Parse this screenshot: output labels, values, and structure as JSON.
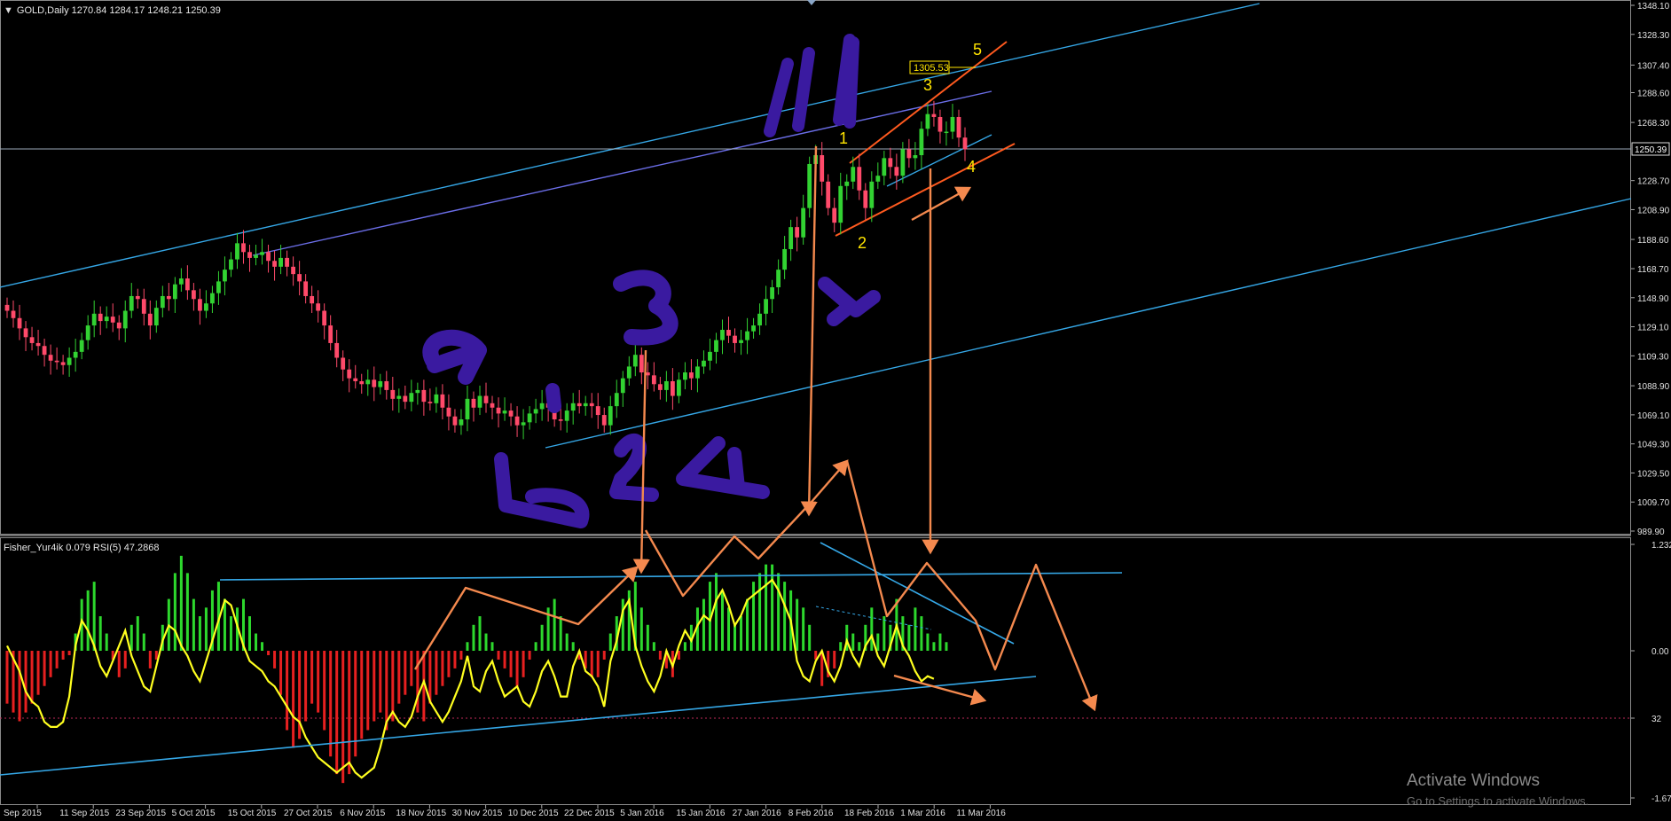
{
  "price_panel": {
    "title": "GOLD,Daily  1270.84 1284.17 1248.21 1250.39",
    "current_price_label": "1250.39",
    "target_label": "1305.53",
    "wave_labels": [
      "1",
      "2",
      "3",
      "4",
      "5"
    ]
  },
  "indicator_panel": {
    "title": "Fisher_Yur4ik 0.079  RSI(5) 47.2868"
  },
  "watermark": {
    "line1": "Activate Windows",
    "line2": "Go to Settings to activate Windows."
  },
  "colors": {
    "up_candle": "#32d232",
    "down_candle": "#ff4a6a",
    "channel_line": "#35a7e6",
    "inner_line": "#6b6ee8",
    "annotation_arrow": "#f4894e",
    "wave_channel": "#ff5a1f",
    "marker_ink": "#3a1aa0",
    "rsi_line": "#ffff1f",
    "fisher_positive": "#2dd82d",
    "fisher_negative": "#e62020",
    "wave_label": "#ffe400"
  },
  "chart_data": [
    {
      "type": "candlestick",
      "title": "GOLD,Daily",
      "price_axis_ticks": [
        "1348.10",
        "1328.30",
        "1307.40",
        "1288.60",
        "1268.30",
        "1250.39",
        "1228.70",
        "1208.90",
        "1188.60",
        "1168.70",
        "1148.90",
        "1129.10",
        "1109.30",
        "1088.90",
        "1069.10",
        "1049.30",
        "1029.50",
        "1009.70",
        "989.90"
      ],
      "ylim": [
        989.9,
        1348.1
      ],
      "date_axis_ticks": [
        "Sep 2015",
        "11 Sep 2015",
        "23 Sep 2015",
        "5 Oct 2015",
        "15 Oct 2015",
        "27 Oct 2015",
        "6 Nov 2015",
        "18 Nov 2015",
        "30 Nov 2015",
        "10 Dec 2015",
        "22 Dec 2015",
        "5 Jan 2016",
        "15 Jan 2016",
        "27 Jan 2016",
        "8 Feb 2016",
        "18 Feb 2016",
        "1 Mar 2016",
        "11 Mar 2016"
      ],
      "close": [
        1140,
        1135,
        1128,
        1122,
        1118,
        1116,
        1110,
        1106,
        1105,
        1103,
        1108,
        1112,
        1120,
        1130,
        1138,
        1133,
        1136,
        1132,
        1128,
        1140,
        1150,
        1148,
        1138,
        1130,
        1142,
        1150,
        1148,
        1158,
        1162,
        1154,
        1148,
        1140,
        1145,
        1152,
        1160,
        1168,
        1175,
        1186,
        1180,
        1176,
        1178,
        1180,
        1174,
        1170,
        1176,
        1170,
        1165,
        1160,
        1150,
        1145,
        1140,
        1130,
        1118,
        1108,
        1100,
        1094,
        1092,
        1090,
        1093,
        1088,
        1092,
        1086,
        1080,
        1082,
        1078,
        1084,
        1086,
        1078,
        1077,
        1083,
        1074,
        1068,
        1062,
        1066,
        1080,
        1074,
        1082,
        1077,
        1074,
        1070,
        1072,
        1068,
        1062,
        1064,
        1070,
        1073,
        1077,
        1074,
        1066,
        1065,
        1072,
        1077,
        1075,
        1077,
        1075,
        1069,
        1062,
        1075,
        1084,
        1094,
        1102,
        1110,
        1098,
        1096,
        1090,
        1086,
        1092,
        1082,
        1093,
        1098,
        1094,
        1102,
        1106,
        1112,
        1120,
        1127,
        1123,
        1118,
        1120,
        1126,
        1130,
        1138,
        1148,
        1156,
        1168,
        1182,
        1197,
        1190,
        1210,
        1240,
        1246,
        1228,
        1210,
        1200,
        1225,
        1228,
        1238,
        1222,
        1210,
        1228,
        1232,
        1244,
        1238,
        1232,
        1250,
        1244,
        1246,
        1264,
        1274,
        1272,
        1262,
        1262,
        1272,
        1258,
        1250
      ]
    },
    {
      "type": "bar",
      "title": "Fisher_Yur4ik",
      "current_value": 0.079,
      "ylim": [
        -1.67,
        1.232
      ],
      "values": [
        -0.6,
        -0.7,
        -0.8,
        -0.7,
        -0.6,
        -0.5,
        -0.4,
        -0.3,
        -0.2,
        -0.1,
        -0.05,
        0.2,
        0.6,
        0.7,
        0.8,
        0.4,
        0.2,
        -0.1,
        -0.3,
        -0.2,
        0.3,
        0.4,
        0.2,
        -0.2,
        -0.1,
        0.3,
        0.6,
        0.9,
        1.1,
        0.9,
        0.6,
        0.4,
        0.5,
        0.7,
        0.8,
        0.6,
        0.4,
        0.5,
        0.6,
        0.4,
        0.2,
        0.1,
        -0.05,
        -0.2,
        -0.5,
        -0.9,
        -1.1,
        -1.0,
        -0.8,
        -0.6,
        -0.7,
        -0.9,
        -1.2,
        -1.4,
        -1.5,
        -1.4,
        -1.2,
        -1.0,
        -0.9,
        -0.8,
        -0.7,
        -0.9,
        -0.8,
        -0.6,
        -0.5,
        -0.4,
        -0.7,
        -0.8,
        -0.6,
        -0.5,
        -0.4,
        -0.3,
        -0.2,
        -0.1,
        0.1,
        0.3,
        0.4,
        0.2,
        0.1,
        -0.1,
        -0.2,
        -0.3,
        -0.4,
        -0.3,
        -0.1,
        0.1,
        0.3,
        0.5,
        0.6,
        0.4,
        0.2,
        0.1,
        -0.1,
        -0.2,
        -0.3,
        -0.3,
        -0.1,
        0.2,
        0.4,
        0.6,
        0.7,
        0.8,
        0.5,
        0.3,
        0.1,
        -0.1,
        -0.2,
        -0.3,
        -0.1,
        0.1,
        0.3,
        0.5,
        0.6,
        0.8,
        0.9,
        0.7,
        0.5,
        0.3,
        0.4,
        0.6,
        0.8,
        0.9,
        1.0,
        1.0,
        0.9,
        0.8,
        0.7,
        0.6,
        0.5,
        0.3,
        -0.1,
        -0.4,
        -0.3,
        -0.2,
        0.1,
        0.3,
        0.2,
        0.1,
        0.3,
        0.5,
        0.2,
        0.4,
        0.3,
        0.6,
        0.4,
        0.3,
        0.5,
        0.4,
        0.2,
        0.1,
        0.2,
        0.1
      ]
    },
    {
      "type": "line",
      "title": "RSI(5)",
      "current_value": 47.2868,
      "level": 32,
      "values": [
        60,
        55,
        50,
        42,
        38,
        36,
        30,
        28,
        28,
        30,
        40,
        60,
        70,
        66,
        60,
        52,
        48,
        54,
        60,
        66,
        56,
        50,
        44,
        42,
        52,
        62,
        68,
        66,
        60,
        56,
        50,
        46,
        54,
        62,
        70,
        78,
        76,
        68,
        60,
        54,
        52,
        50,
        46,
        44,
        40,
        36,
        32,
        30,
        24,
        20,
        16,
        14,
        12,
        10,
        12,
        14,
        10,
        8,
        10,
        12,
        20,
        30,
        34,
        30,
        28,
        32,
        40,
        46,
        38,
        34,
        30,
        34,
        40,
        46,
        56,
        44,
        42,
        50,
        54,
        46,
        40,
        42,
        44,
        38,
        36,
        42,
        50,
        54,
        48,
        40,
        40,
        52,
        58,
        50,
        48,
        44,
        36,
        54,
        62,
        74,
        78,
        60,
        52,
        46,
        42,
        48,
        58,
        52,
        60,
        66,
        62,
        68,
        72,
        70,
        78,
        82,
        76,
        68,
        72,
        78,
        80,
        82,
        84,
        86,
        82,
        76,
        70,
        54,
        48,
        46,
        54,
        58,
        50,
        46,
        52,
        62,
        56,
        52,
        60,
        64,
        56,
        52,
        60,
        68,
        60,
        56,
        50,
        46,
        48,
        47
      ]
    }
  ],
  "indicator_axis": {
    "ticks": [
      "1.232",
      "0.00",
      "32",
      "-1.67"
    ]
  }
}
